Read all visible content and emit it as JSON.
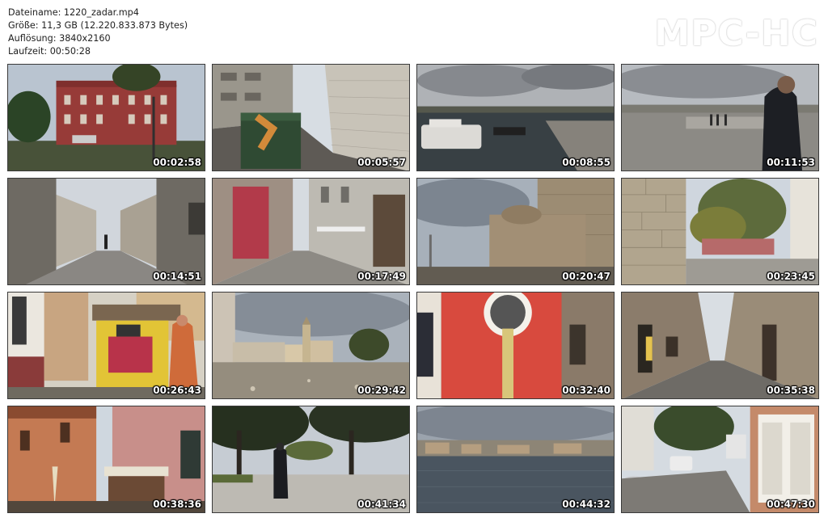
{
  "info": {
    "filename": "Dateiname: 1220_zadar.mp4",
    "size": "Größe: 11,3 GB (12.220.833.873 Bytes)",
    "resolution": "Auflösung: 3840x2160",
    "duration": "Laufzeit: 00:50:28"
  },
  "logo": "MPC-HC",
  "thumbnails": [
    {
      "time": "00:02:58",
      "scene": "red-building"
    },
    {
      "time": "00:05:57",
      "scene": "alley-bins"
    },
    {
      "time": "00:08:55",
      "scene": "harbor-boats"
    },
    {
      "time": "00:11:53",
      "scene": "promenade-man"
    },
    {
      "time": "00:14:51",
      "scene": "archway-street"
    },
    {
      "time": "00:17:49",
      "scene": "shop-street"
    },
    {
      "time": "00:20:47",
      "scene": "stone-church"
    },
    {
      "time": "00:23:45",
      "scene": "stone-wall-park"
    },
    {
      "time": "00:26:43",
      "scene": "cart-vendor"
    },
    {
      "time": "00:29:42",
      "scene": "square-tower"
    },
    {
      "time": "00:32:40",
      "scene": "red-door"
    },
    {
      "time": "00:35:38",
      "scene": "narrow-lane"
    },
    {
      "time": "00:38:36",
      "scene": "cafe-square"
    },
    {
      "time": "00:41:34",
      "scene": "tree-walk"
    },
    {
      "time": "00:44:32",
      "scene": "waterfront"
    },
    {
      "time": "00:47:30",
      "scene": "parked-cars-street"
    }
  ]
}
